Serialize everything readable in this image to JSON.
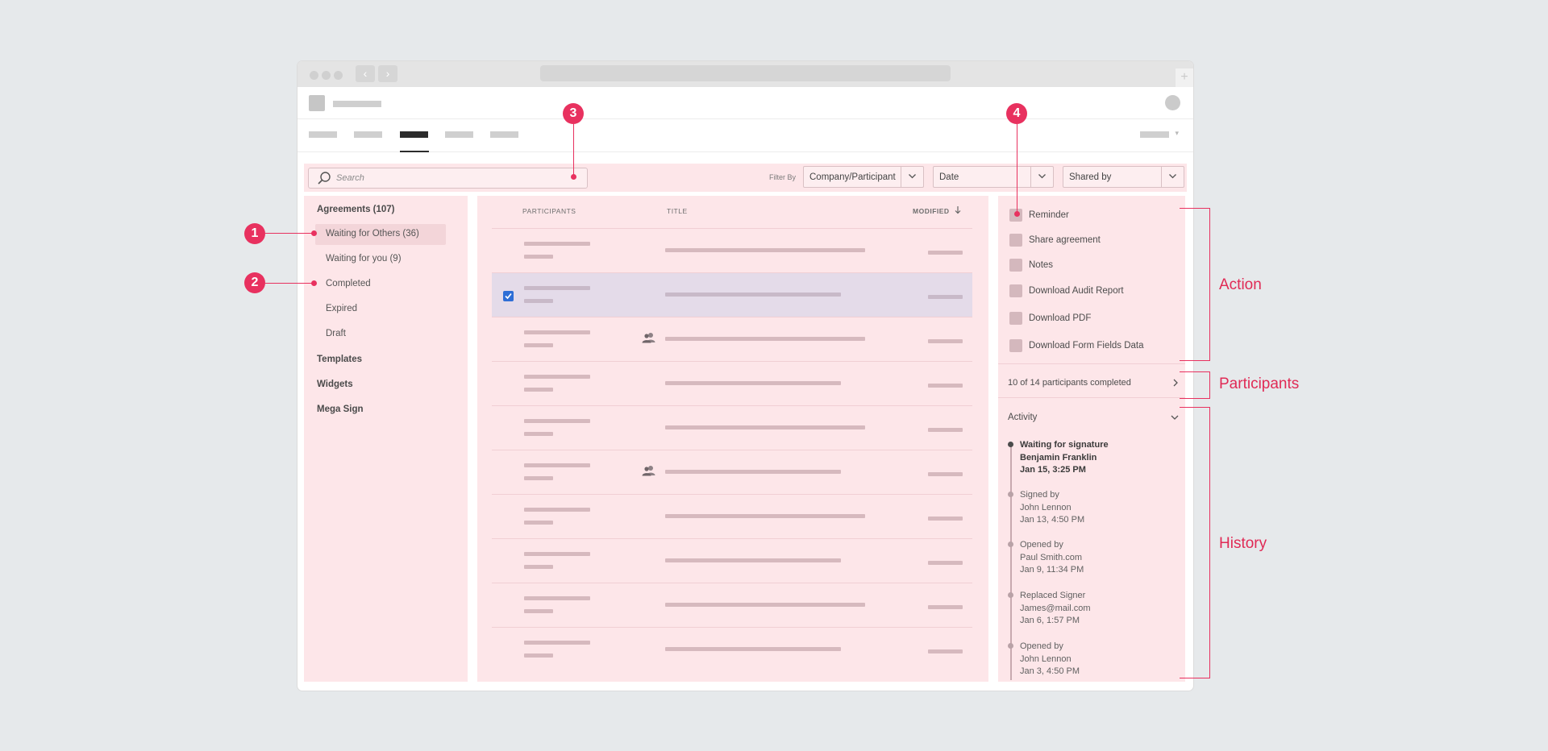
{
  "colors": {
    "annotation": "#e8315f",
    "panel": "#fde6e9",
    "checkbox": "#2e6ed6"
  },
  "search": {
    "placeholder": "Search"
  },
  "filter": {
    "label": "Filter By",
    "selects": [
      "Company/Participant",
      "Date",
      "Shared by"
    ]
  },
  "sidebar": {
    "items": [
      {
        "label": "Agreements (107)"
      },
      {
        "label": "Waiting for Others (36)"
      },
      {
        "label": "Waiting for you (9)"
      },
      {
        "label": "Completed"
      },
      {
        "label": "Expired"
      },
      {
        "label": "Draft"
      },
      {
        "label": "Templates"
      },
      {
        "label": "Widgets"
      },
      {
        "label": "Mega Sign"
      }
    ]
  },
  "table": {
    "columns": [
      "PARTICIPANTS",
      "TITLE",
      "MODIFIED"
    ],
    "sort_icon": "arrow-down-icon",
    "selected_row": 2,
    "group_icon_rows": [
      3,
      6
    ]
  },
  "actions": [
    "Reminder",
    "Share agreement",
    "Notes",
    "Download Audit Report",
    "Download PDF",
    "Download Form Fields Data"
  ],
  "participants": {
    "text": "10 of 14 participants completed"
  },
  "activity": {
    "header": "Activity",
    "events": [
      {
        "lines": [
          "Waiting for signature",
          "Benjamin Franklin",
          "Jan 15, 3:25 PM"
        ]
      },
      {
        "lines": [
          "Signed by",
          "John Lennon",
          "Jan 13, 4:50 PM"
        ]
      },
      {
        "lines": [
          "Opened by",
          "Paul Smith.com",
          "Jan 9, 11:34 PM"
        ]
      },
      {
        "lines": [
          "Replaced Signer",
          "James@mail.com",
          "Jan 6, 1:57 PM"
        ]
      },
      {
        "lines": [
          "Opened by",
          "John Lennon",
          "Jan 3, 4:50 PM"
        ]
      }
    ]
  },
  "annotations": {
    "callouts": [
      "1",
      "2",
      "3",
      "4"
    ],
    "brackets": [
      "Action",
      "Participants",
      "History"
    ]
  }
}
